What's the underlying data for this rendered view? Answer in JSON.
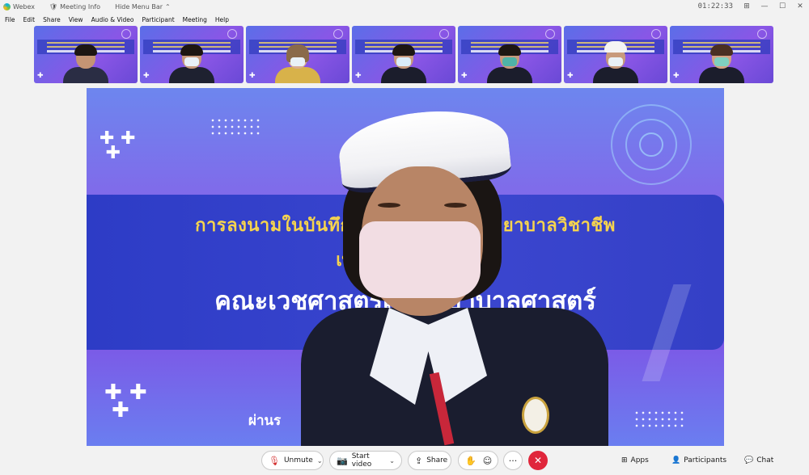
{
  "titlebar": {
    "app_name": "Webex",
    "meeting_info": "Meeting Info",
    "hide_menu_bar": "Hide Menu Bar",
    "clock": "01:22:33"
  },
  "menu": [
    "File",
    "Edit",
    "Share",
    "View",
    "Audio & Video",
    "Participant",
    "Meeting",
    "Help"
  ],
  "stage_slide": {
    "line1": "การลงนามในบันทึกข้อตกลง          การผลิตพยาบาลวิชาชีพ",
    "line2": "เพื่อคณะเว                 ะหว่าง",
    "line3": "คณะเวชศาสตร์เขตร้          ยาบาลศาสตร์",
    "bottom": "ผ่านร"
  },
  "thumbnail_count": 7,
  "toolbar": {
    "unmute": "Unmute",
    "start_video": "Start video",
    "share": "Share",
    "more": "···",
    "apps": "Apps",
    "participants": "Participants",
    "chat": "Chat"
  },
  "colors": {
    "end_call": "#e0263b",
    "slide_yellow": "#f6d44e",
    "slide_band": "#2d3cc6"
  }
}
